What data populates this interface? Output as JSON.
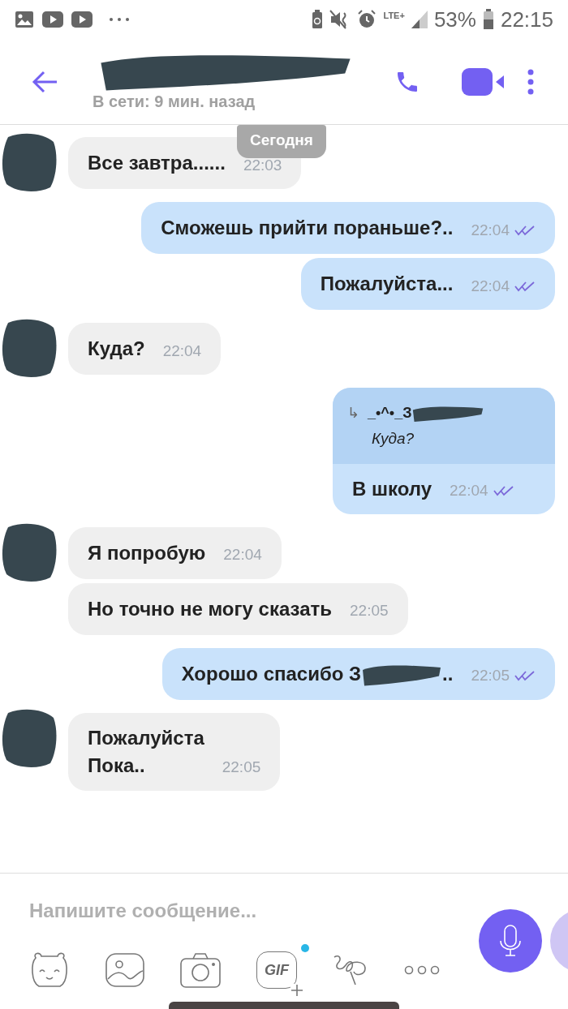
{
  "status_bar": {
    "network": "LTE+",
    "battery": "53%",
    "time": "22:15"
  },
  "header": {
    "subtitle": "В сети: 9 мин. назад"
  },
  "date_chip": "Сегодня",
  "messages": [
    {
      "kind": "in",
      "avatar": true,
      "text": "Все завтра......",
      "time": "22:03"
    },
    {
      "kind": "out",
      "text": "Сможешь прийти пораньше?..",
      "time": "22:04",
      "read": true
    },
    {
      "kind": "out",
      "text": "Пожалуйста...",
      "time": "22:04",
      "read": true
    },
    {
      "kind": "in",
      "avatar": true,
      "text": "Куда?",
      "time": "22:04"
    },
    {
      "kind": "out",
      "quote": {
        "arrow": "↳",
        "author": "_•^•_З",
        "text": "Куда?"
      },
      "text": "В школу",
      "time": "22:04",
      "read": true
    },
    {
      "kind": "in",
      "avatar": true,
      "text": "Я попробую",
      "time": "22:04"
    },
    {
      "kind": "in",
      "avatar": false,
      "text": "Но точно не могу сказать",
      "time": "22:05"
    },
    {
      "kind": "out",
      "text": "Хорошо спасибо З",
      "redacted": true,
      "text_end": "..",
      "time": "22:05",
      "read": true
    },
    {
      "kind": "in",
      "avatar": true,
      "text": "Пожалуйста\nПока..",
      "time": "22:05"
    }
  ],
  "composer": {
    "placeholder": "Напишите сообщение...",
    "gif_label": "GIF",
    "gif_new": true
  }
}
